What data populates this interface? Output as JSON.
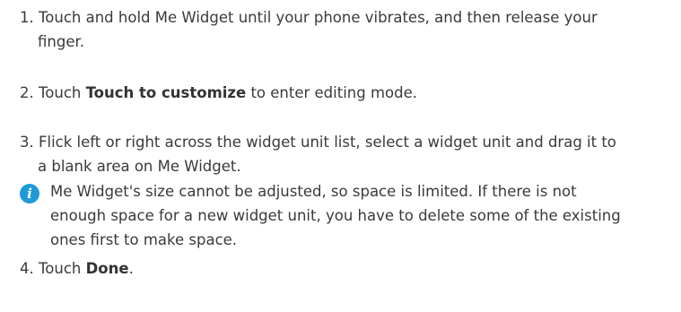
{
  "steps": [
    {
      "number": "1.",
      "line1": "Touch and hold Me Widget until your phone vibrates, and then release your",
      "line2": "finger."
    },
    {
      "number": "2.",
      "before": "Touch ",
      "bold": "Touch to customize",
      "after": " to enter editing mode."
    },
    {
      "number": "3.",
      "line1": "Flick left or right across the widget unit list, select a widget unit and drag it to",
      "line2": "a blank area on Me Widget."
    },
    {
      "number": "4.",
      "before": "Touch ",
      "bold": "Done",
      "after": "."
    }
  ],
  "note": {
    "icon": "info-icon",
    "icon_glyph": "i",
    "icon_color": "#1e9ad6",
    "line1": "Me Widget's size cannot be adjusted, so space is limited. If there is not",
    "line2": "enough space for a new widget unit, you have to delete some of the existing",
    "line3": "ones first to make space."
  }
}
